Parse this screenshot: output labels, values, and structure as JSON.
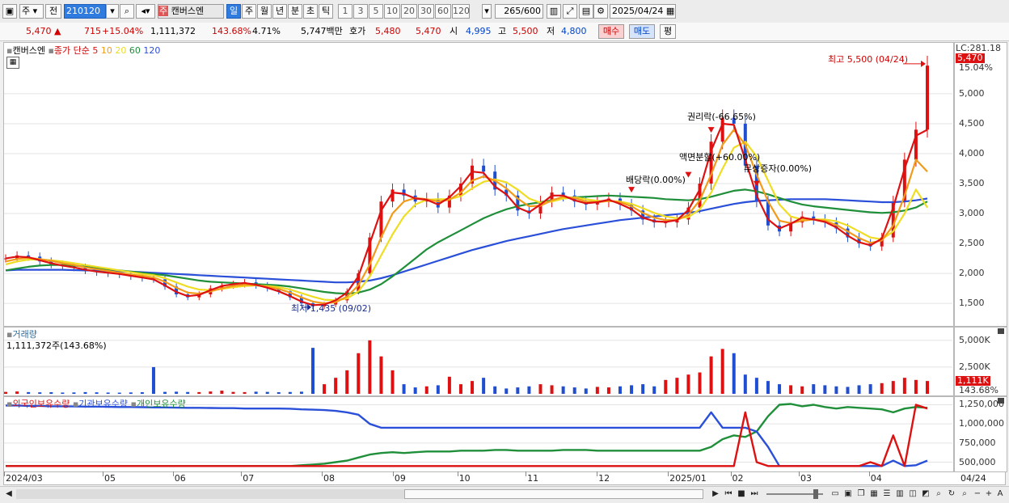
{
  "toolbar": {
    "type_label": "주",
    "prev_label": "전",
    "code_value": "210120",
    "stock_name": "캔버스엔",
    "stock_badge": "주",
    "periods": [
      "일",
      "주",
      "월",
      "년",
      "분",
      "초",
      "틱"
    ],
    "active_period": "일",
    "counts": [
      "1",
      "3",
      "5",
      "10",
      "20",
      "30",
      "60",
      "120"
    ],
    "bars_shown": "265",
    "bars_total": "/600",
    "date_value": "2025/04/24"
  },
  "quote": {
    "price": "5,470",
    "change": "715",
    "change_pct": "+15.04%",
    "volume": "1,111,372",
    "volume_ratio": "143.68%",
    "turnover": "4.71%",
    "amount": "5,747백만",
    "ask_label": "호가",
    "ask_price": "5,480",
    "bid_price": "5,470",
    "open_label": "시",
    "open_value": "4,995",
    "high_label": "고",
    "high_value": "5,500",
    "low_label": "저",
    "low_value": "4,800",
    "buy_label": "매수",
    "sell_label": "매도",
    "eval_label": "평"
  },
  "price_pane": {
    "legend_name": "캔버스엔",
    "legend_series": "종가 단순",
    "ma_labels": [
      "5",
      "10",
      "20",
      "60",
      "120"
    ],
    "ma_colors": [
      "#dd1111",
      "#f29a1a",
      "#eedd22",
      "#1f8f3a",
      "#2a4fd8"
    ],
    "top_label": "LC:281.18",
    "price_tag": "5,470",
    "pct_tag": "15.04%",
    "annotations": {
      "high": "최고 5,500 (04/24)",
      "low": "최저 1,435 (09/02)",
      "rights": "권리락(-66.65%)",
      "split": "액면분할(+60.00%)",
      "dividend": "배당락(0.00%)",
      "bonus": "무상증자(0.00%)"
    }
  },
  "volume_pane": {
    "title": "거래량",
    "info": "1,111,372주(143.68%)",
    "tag": "1,111K",
    "pct_tag": "143.68%"
  },
  "holding_pane": {
    "labels": [
      "외국인보유수량",
      "기관보유수량",
      "개인보유수량"
    ],
    "colors": [
      "#dd1111",
      "#2a4fd8",
      "#1f8f3a"
    ]
  },
  "chart_data": {
    "type": "line",
    "price_axis": {
      "ticks": [
        "5,000",
        "4,500",
        "4,000",
        "3,500",
        "3,000",
        "2,500",
        "2,000",
        "1,500"
      ],
      "values": [
        5000,
        4500,
        4000,
        3500,
        3000,
        2500,
        2000,
        1500
      ],
      "ylim": [
        1150,
        5850
      ]
    },
    "volume_axis": {
      "ticks": [
        "5,000K",
        "2,500K"
      ],
      "values": [
        5000,
        2500
      ],
      "ylim": [
        0,
        6200
      ]
    },
    "holding_axis": {
      "ticks": [
        "1,250,000",
        "1,000,000",
        "750,000",
        "500,000"
      ],
      "values": [
        1250000,
        1000000,
        750000,
        500000
      ],
      "ylim": [
        400000,
        1350000
      ]
    },
    "x_labels": [
      "2024/03",
      "05",
      "06",
      "07",
      "08",
      "09",
      "10",
      "11",
      "12",
      "2025/01",
      "02",
      "03",
      "04",
      "04/24"
    ],
    "close": [
      2250,
      2300,
      2280,
      2200,
      2150,
      2120,
      2100,
      2050,
      2020,
      2000,
      1980,
      1950,
      1920,
      1900,
      1780,
      1650,
      1600,
      1650,
      1750,
      1800,
      1820,
      1850,
      1800,
      1750,
      1700,
      1600,
      1500,
      1450,
      1480,
      1550,
      1700,
      2000,
      2600,
      3200,
      3400,
      3300,
      3200,
      3250,
      3100,
      3300,
      3500,
      3800,
      3700,
      3400,
      3300,
      3050,
      3000,
      3200,
      3350,
      3300,
      3200,
      3150,
      3200,
      3250,
      3150,
      3050,
      2900,
      2850,
      2850,
      2900,
      3100,
      3500,
      4200,
      4600,
      4500,
      3800,
      3200,
      2800,
      2700,
      2850,
      2950,
      2900,
      2850,
      2750,
      2600,
      2500,
      2450,
      2600,
      3200,
      3900,
      4400,
      5470
    ],
    "ma_series": [
      {
        "name": "5",
        "values": [
          2250,
          2280,
          2270,
          2220,
          2170,
          2130,
          2100,
          2060,
          2030,
          2010,
          1990,
          1960,
          1930,
          1900,
          1800,
          1690,
          1620,
          1640,
          1720,
          1790,
          1820,
          1840,
          1810,
          1760,
          1700,
          1620,
          1530,
          1470,
          1480,
          1550,
          1680,
          1950,
          2500,
          3050,
          3350,
          3330,
          3250,
          3230,
          3150,
          3270,
          3460,
          3700,
          3680,
          3450,
          3320,
          3100,
          3020,
          3150,
          3300,
          3300,
          3220,
          3170,
          3190,
          3230,
          3160,
          3070,
          2930,
          2870,
          2860,
          2890,
          3060,
          3400,
          4050,
          4500,
          4480,
          3900,
          3300,
          2900,
          2750,
          2830,
          2930,
          2900,
          2860,
          2770,
          2630,
          2520,
          2470,
          2580,
          3100,
          3750,
          4300,
          4400
        ]
      },
      {
        "name": "10",
        "values": [
          2200,
          2240,
          2260,
          2240,
          2210,
          2170,
          2140,
          2100,
          2070,
          2040,
          2010,
          1980,
          1960,
          1930,
          1860,
          1760,
          1680,
          1660,
          1700,
          1750,
          1790,
          1810,
          1800,
          1780,
          1740,
          1680,
          1600,
          1530,
          1500,
          1520,
          1610,
          1800,
          2150,
          2600,
          3000,
          3200,
          3260,
          3240,
          3200,
          3230,
          3350,
          3550,
          3620,
          3550,
          3420,
          3250,
          3120,
          3130,
          3220,
          3280,
          3260,
          3200,
          3190,
          3210,
          3190,
          3120,
          3010,
          2930,
          2890,
          2890,
          2980,
          3220,
          3650,
          4150,
          4400,
          4150,
          3650,
          3200,
          2880,
          2840,
          2880,
          2900,
          2880,
          2810,
          2700,
          2590,
          2510,
          2550,
          2800,
          3300,
          3900,
          3700
        ]
      },
      {
        "name": "20",
        "values": [
          2150,
          2200,
          2230,
          2230,
          2220,
          2200,
          2170,
          2140,
          2110,
          2080,
          2050,
          2020,
          1990,
          1970,
          1920,
          1850,
          1780,
          1730,
          1720,
          1740,
          1770,
          1790,
          1800,
          1790,
          1770,
          1730,
          1670,
          1610,
          1560,
          1550,
          1580,
          1700,
          1950,
          2300,
          2650,
          2950,
          3150,
          3230,
          3240,
          3240,
          3290,
          3420,
          3530,
          3570,
          3520,
          3400,
          3250,
          3180,
          3200,
          3250,
          3270,
          3240,
          3210,
          3210,
          3200,
          3160,
          3090,
          3010,
          2950,
          2920,
          2940,
          3070,
          3350,
          3750,
          4100,
          4200,
          3950,
          3550,
          3150,
          2950,
          2900,
          2900,
          2900,
          2870,
          2800,
          2700,
          2600,
          2570,
          2700,
          3000,
          3400,
          3100
        ]
      },
      {
        "name": "60",
        "values": [
          2050,
          2080,
          2110,
          2130,
          2140,
          2140,
          2130,
          2110,
          2090,
          2070,
          2050,
          2030,
          2010,
          1990,
          1970,
          1940,
          1910,
          1880,
          1860,
          1850,
          1840,
          1830,
          1820,
          1810,
          1800,
          1780,
          1750,
          1720,
          1690,
          1670,
          1660,
          1680,
          1730,
          1820,
          1950,
          2100,
          2250,
          2400,
          2520,
          2620,
          2720,
          2820,
          2920,
          3000,
          3070,
          3120,
          3160,
          3190,
          3220,
          3250,
          3270,
          3280,
          3290,
          3300,
          3290,
          3280,
          3270,
          3260,
          3240,
          3230,
          3220,
          3240,
          3280,
          3330,
          3380,
          3400,
          3370,
          3320,
          3260,
          3200,
          3150,
          3120,
          3100,
          3080,
          3060,
          3040,
          3020,
          3010,
          3020,
          3050,
          3100,
          3200
        ]
      },
      {
        "name": "120",
        "values": [
          2050,
          2060,
          2060,
          2060,
          2060,
          2060,
          2055,
          2050,
          2045,
          2040,
          2035,
          2030,
          2020,
          2010,
          2000,
          1990,
          1980,
          1970,
          1960,
          1950,
          1940,
          1930,
          1920,
          1910,
          1900,
          1890,
          1880,
          1870,
          1860,
          1850,
          1850,
          1860,
          1880,
          1920,
          1970,
          2030,
          2090,
          2150,
          2210,
          2270,
          2330,
          2390,
          2440,
          2490,
          2540,
          2580,
          2620,
          2660,
          2700,
          2740,
          2770,
          2800,
          2830,
          2860,
          2890,
          2910,
          2930,
          2950,
          2970,
          2990,
          3010,
          3040,
          3080,
          3120,
          3160,
          3190,
          3210,
          3220,
          3230,
          3240,
          3240,
          3240,
          3240,
          3230,
          3220,
          3210,
          3200,
          3190,
          3190,
          3200,
          3220,
          3250
        ]
      }
    ],
    "volume": [
      180,
      220,
      160,
      140,
      150,
      120,
      130,
      160,
      140,
      120,
      110,
      130,
      150,
      2500,
      180,
      200,
      170,
      160,
      220,
      300,
      180,
      160,
      200,
      180,
      150,
      170,
      200,
      4300,
      900,
      1500,
      2200,
      3800,
      5000,
      3500,
      2200,
      900,
      600,
      700,
      800,
      1600,
      900,
      1200,
      1500,
      700,
      500,
      600,
      700,
      900,
      800,
      700,
      600,
      500,
      650,
      600,
      700,
      800,
      900,
      700,
      1300,
      1500,
      1800,
      2000,
      3500,
      4200,
      3800,
      1800,
      1500,
      1200,
      900,
      800,
      700,
      900,
      800,
      700,
      650,
      800,
      900,
      1000,
      1200,
      1500,
      1300,
      1200
    ],
    "foreign_holding": [
      450000,
      450000,
      450000,
      450000,
      450000,
      450000,
      450000,
      450000,
      450000,
      450000,
      450000,
      450000,
      450000,
      450000,
      450000,
      450000,
      450000,
      450000,
      450000,
      450000,
      450000,
      450000,
      450000,
      450000,
      450000,
      450000,
      450000,
      450000,
      450000,
      450000,
      450000,
      450000,
      450000,
      450000,
      450000,
      450000,
      450000,
      450000,
      450000,
      450000,
      450000,
      450000,
      450000,
      450000,
      450000,
      450000,
      450000,
      450000,
      450000,
      450000,
      450000,
      450000,
      450000,
      450000,
      450000,
      450000,
      450000,
      450000,
      450000,
      450000,
      450000,
      450000,
      450000,
      450000,
      450000,
      1150000,
      500000,
      450000,
      450000,
      450000,
      450000,
      450000,
      450000,
      450000,
      450000,
      450000,
      500000,
      450000,
      850000,
      450000,
      1250000,
      1200000
    ],
    "institution_holding": [
      1240000,
      1240000,
      1235000,
      1235000,
      1230000,
      1230000,
      1228000,
      1225000,
      1225000,
      1222000,
      1220000,
      1220000,
      1218000,
      1215000,
      1215000,
      1212000,
      1210000,
      1210000,
      1208000,
      1205000,
      1205000,
      1200000,
      1200000,
      1200000,
      1200000,
      1198000,
      1190000,
      1185000,
      1180000,
      1170000,
      1150000,
      1120000,
      1000000,
      950000,
      950000,
      950000,
      950000,
      950000,
      950000,
      950000,
      950000,
      950000,
      950000,
      950000,
      950000,
      950000,
      950000,
      950000,
      950000,
      950000,
      950000,
      950000,
      950000,
      950000,
      950000,
      950000,
      950000,
      950000,
      950000,
      950000,
      950000,
      950000,
      1150000,
      950000,
      950000,
      950000,
      900000,
      700000,
      450000,
      450000,
      450000,
      450000,
      450000,
      450000,
      450000,
      450000,
      450000,
      450000,
      520000,
      450000,
      460000,
      520000
    ],
    "individual_holding": [
      450000,
      450000,
      450000,
      450000,
      450000,
      450000,
      450000,
      450000,
      450000,
      450000,
      450000,
      450000,
      450000,
      450000,
      450000,
      450000,
      450000,
      450000,
      450000,
      450000,
      450000,
      450000,
      450000,
      450000,
      450000,
      450000,
      460000,
      470000,
      480000,
      500000,
      520000,
      560000,
      600000,
      620000,
      630000,
      620000,
      630000,
      640000,
      640000,
      640000,
      650000,
      650000,
      650000,
      660000,
      660000,
      650000,
      650000,
      650000,
      650000,
      660000,
      660000,
      660000,
      650000,
      650000,
      650000,
      650000,
      650000,
      650000,
      650000,
      650000,
      650000,
      650000,
      700000,
      800000,
      850000,
      830000,
      900000,
      1100000,
      1250000,
      1260000,
      1230000,
      1250000,
      1220000,
      1200000,
      1220000,
      1210000,
      1200000,
      1190000,
      1150000,
      1200000,
      1220000,
      1210000
    ]
  }
}
